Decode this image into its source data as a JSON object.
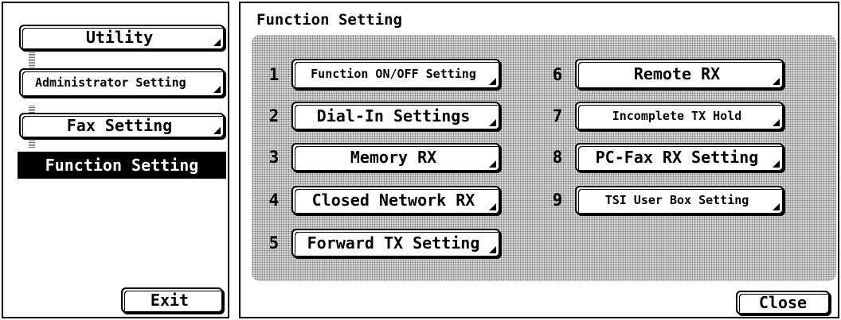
{
  "sidebar": {
    "items": [
      {
        "label": "Utility"
      },
      {
        "label": "Administrator Setting"
      },
      {
        "label": "Fax Setting"
      },
      {
        "label": "Function Setting"
      }
    ],
    "exit_label": "Exit"
  },
  "main": {
    "title": "Function Setting",
    "functions": [
      {
        "num": "1",
        "label": "Function ON/OFF Setting"
      },
      {
        "num": "2",
        "label": "Dial-In Settings"
      },
      {
        "num": "3",
        "label": "Memory RX"
      },
      {
        "num": "4",
        "label": "Closed Network RX"
      },
      {
        "num": "5",
        "label": "Forward TX Setting"
      },
      {
        "num": "6",
        "label": "Remote RX"
      },
      {
        "num": "7",
        "label": "Incomplete TX Hold"
      },
      {
        "num": "8",
        "label": "PC-Fax RX Setting"
      },
      {
        "num": "9",
        "label": "TSI User Box Setting"
      }
    ],
    "close_label": "Close"
  }
}
